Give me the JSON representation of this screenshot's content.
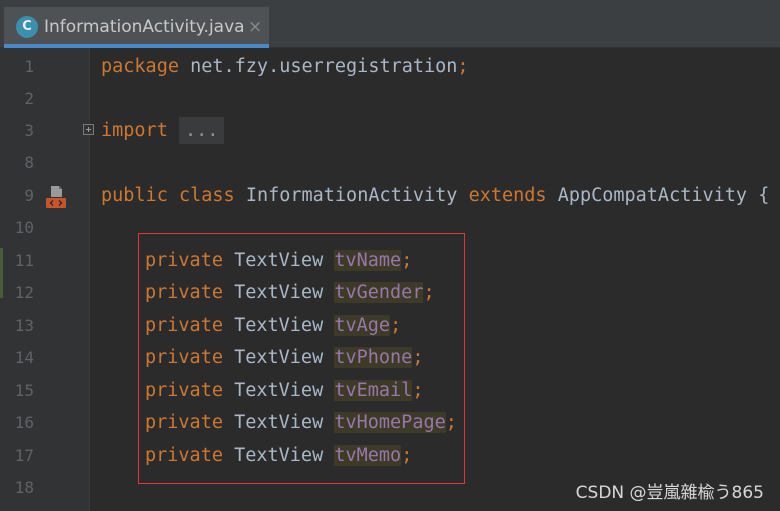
{
  "tab": {
    "icon_letter": "C",
    "title": "InformationActivity.java",
    "close": "×"
  },
  "editor": {
    "lines": [
      {
        "no": "1",
        "text": "package net.fzy.userregistration;"
      },
      {
        "no": "2",
        "text": ""
      },
      {
        "no": "3",
        "text": "import ..."
      },
      {
        "no": "8",
        "text": ""
      },
      {
        "no": "9",
        "text": "public class InformationActivity extends AppCompatActivity {"
      },
      {
        "no": "10",
        "text": ""
      },
      {
        "no": "11",
        "text": "private TextView tvName;"
      },
      {
        "no": "12",
        "text": "private TextView tvGender;"
      },
      {
        "no": "13",
        "text": "private TextView tvAge;"
      },
      {
        "no": "14",
        "text": "private TextView tvPhone;"
      },
      {
        "no": "15",
        "text": "private TextView tvEmail;"
      },
      {
        "no": "16",
        "text": "private TextView tvHomePage;"
      },
      {
        "no": "17",
        "text": "private TextView tvMemo;"
      },
      {
        "no": "18",
        "text": ""
      }
    ],
    "tokens": {
      "package_kw": "package",
      "package_name": "net.fzy.userregistration",
      "semicolon": ";",
      "import_kw": "import",
      "import_folded": "...",
      "public_kw": "public",
      "class_kw": "class",
      "class_name": "InformationActivity",
      "extends_kw": "extends",
      "parent_class": "AppCompatActivity",
      "open_brace": "{",
      "private_kw": "private",
      "field_type": "TextView",
      "fields": [
        "tvName",
        "tvGender",
        "tvAge",
        "tvPhone",
        "tvEmail",
        "tvHomePage",
        "tvMemo"
      ]
    }
  },
  "watermark": "CSDN @豈嵐雜楡う865",
  "colors": {
    "keyword": "#cc7832",
    "field": "#9876aa",
    "plain": "#a9b7c6",
    "annotation_box": "#d63a3a",
    "tab_underline": "#4a88c7"
  }
}
